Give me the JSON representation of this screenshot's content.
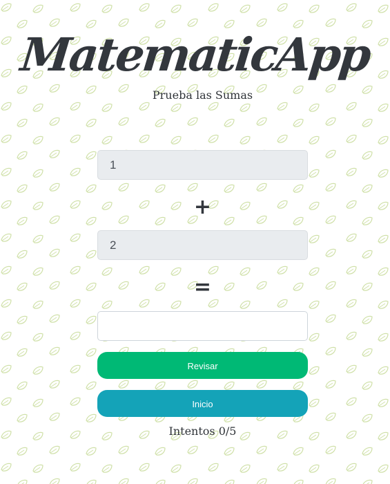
{
  "app": {
    "title": "MatematicApp",
    "subtitle": "Prueba las Sumas"
  },
  "exercise": {
    "operand_1": "1",
    "operator_plus": "+",
    "operand_2": "2",
    "operator_equals": "=",
    "answer_value": ""
  },
  "buttons": {
    "check_label": "Revisar",
    "start_label": "Inicio"
  },
  "status": {
    "attempts_text": "Intentos 0/5"
  },
  "colors": {
    "check_button": "#00b975",
    "start_button": "#14a3b8",
    "title_text": "#33373d",
    "leaf_pattern": "#c9dca0"
  },
  "icons": {
    "background": "leaf-icon"
  }
}
